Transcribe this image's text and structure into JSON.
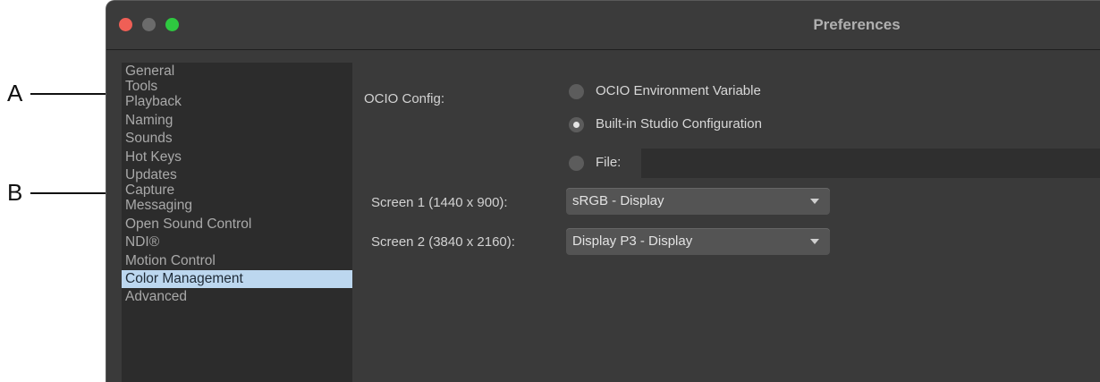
{
  "callouts": {
    "a": "A",
    "b": "B"
  },
  "window": {
    "title": "Preferences"
  },
  "sidebar": {
    "items": [
      {
        "label": "General"
      },
      {
        "label": "Tools"
      },
      {
        "label": "Playback"
      },
      {
        "label": "Naming"
      },
      {
        "label": "Sounds"
      },
      {
        "label": "Hot Keys"
      },
      {
        "label": "Updates"
      },
      {
        "label": "Capture"
      },
      {
        "label": "Messaging"
      },
      {
        "label": "Open Sound Control"
      },
      {
        "label": "NDI®"
      },
      {
        "label": "Motion Control"
      },
      {
        "label": "Color Management"
      },
      {
        "label": "Advanced"
      }
    ],
    "selected": "Color Management"
  },
  "ocio": {
    "label": "OCIO Config:",
    "options": [
      {
        "label": "OCIO Environment Variable",
        "checked": false
      },
      {
        "label": "Built-in Studio Configuration",
        "checked": true
      },
      {
        "label": "File:",
        "checked": false
      }
    ],
    "file_value": ""
  },
  "screens": [
    {
      "label": "Screen 1 (1440 x 900):",
      "value": "sRGB - Display"
    },
    {
      "label": "Screen 2 (3840 x 2160):",
      "value": "Display P3 - Display"
    }
  ],
  "colors": {
    "selection": "#bcd7ef",
    "close": "#ef5f56",
    "maximize": "#2ec840",
    "window_bg": "#3a3a3a"
  }
}
